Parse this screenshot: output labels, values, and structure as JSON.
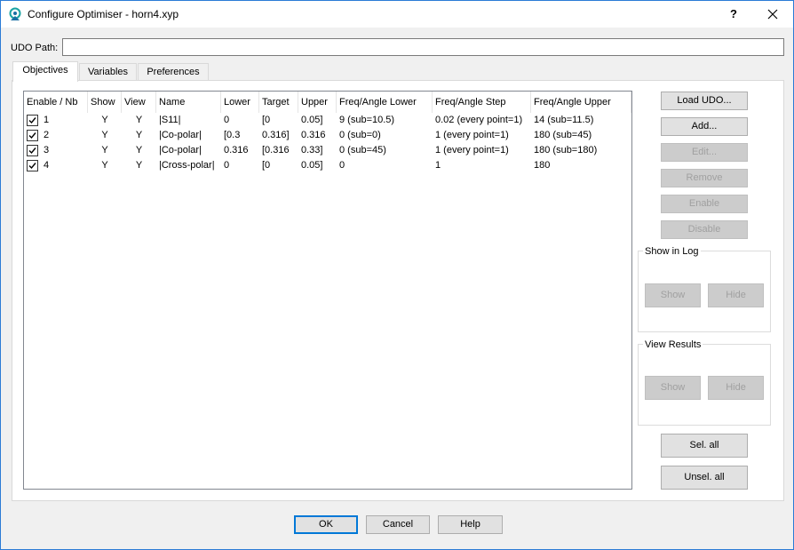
{
  "window": {
    "title": "Configure Optimiser - horn4.xyp",
    "help_label": "?"
  },
  "udo": {
    "label": "UDO Path:",
    "value": "",
    "placeholder": ""
  },
  "tabs": [
    {
      "label": "Objectives"
    },
    {
      "label": "Variables"
    },
    {
      "label": "Preferences"
    }
  ],
  "table": {
    "columns": [
      "Enable / Nb",
      "Show",
      "View",
      "Name",
      "Lower",
      "Target",
      "Upper",
      "Freq/Angle Lower",
      "Freq/Angle Step",
      "Freq/Angle Upper"
    ],
    "rows": [
      {
        "nb": "1",
        "show": "Y",
        "view": "Y",
        "name": "|S11|",
        "lower": "0",
        "target": "[0",
        "upper": "0.05]",
        "fa_lower": "9 (sub=10.5)",
        "fa_step": "0.02 (every point=1)",
        "fa_upper": "14 (sub=11.5)"
      },
      {
        "nb": "2",
        "show": "Y",
        "view": "Y",
        "name": "|Co-polar|",
        "lower": "[0.3",
        "target": "0.316]",
        "upper": "0.316",
        "fa_lower": "0 (sub=0)",
        "fa_step": "1 (every point=1)",
        "fa_upper": "180 (sub=45)"
      },
      {
        "nb": "3",
        "show": "Y",
        "view": "Y",
        "name": "|Co-polar|",
        "lower": "0.316",
        "target": "[0.316",
        "upper": "0.33]",
        "fa_lower": "0 (sub=45)",
        "fa_step": "1 (every point=1)",
        "fa_upper": "180 (sub=180)"
      },
      {
        "nb": "4",
        "show": "Y",
        "view": "Y",
        "name": "|Cross-polar|",
        "lower": "0",
        "target": "[0",
        "upper": "0.05]",
        "fa_lower": "0",
        "fa_step": "1",
        "fa_upper": "180"
      }
    ]
  },
  "side_buttons": {
    "load_udo": "Load UDO...",
    "add": "Add...",
    "edit": "Edit...",
    "remove": "Remove",
    "enable": "Enable",
    "disable": "Disable"
  },
  "show_in_log": {
    "title": "Show in Log",
    "show": "Show",
    "hide": "Hide"
  },
  "view_results": {
    "title": "View Results",
    "show": "Show",
    "hide": "Hide"
  },
  "selection": {
    "select_all": "Sel. all",
    "unselect_all": "Unsel. all"
  },
  "footer": {
    "ok": "OK",
    "cancel": "Cancel",
    "help": "Help"
  },
  "colors": {
    "accent": "#0078d7",
    "window_border": "#2b7bd6",
    "icon": "#1aa3a3"
  }
}
